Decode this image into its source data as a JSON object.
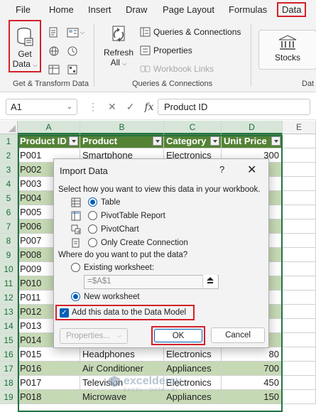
{
  "ribbon": {
    "tabs": [
      "File",
      "Home",
      "Insert",
      "Draw",
      "Page Layout",
      "Formulas",
      "Data"
    ],
    "active_tab": "Data",
    "get_data_label_1": "Get",
    "get_data_label_2": "Data",
    "refresh_label_1": "Refresh",
    "refresh_label_2": "All",
    "queries_connections": "Queries & Connections",
    "properties": "Properties",
    "workbook_links": "Workbook Links",
    "stocks": "Stocks",
    "group_get_transform": "Get & Transform Data",
    "group_queries": "Queries & Connections",
    "group_datatypes_partial": "Dat"
  },
  "formula_bar": {
    "name_box": "A1",
    "fx_symbol": "fx",
    "value": "Product ID"
  },
  "grid": {
    "columns": [
      "A",
      "B",
      "C",
      "D",
      "E"
    ],
    "rows": [
      "1",
      "2",
      "3",
      "4",
      "5",
      "6",
      "7",
      "8",
      "9",
      "10",
      "11",
      "12",
      "13",
      "14",
      "15",
      "16",
      "17",
      "18",
      "19"
    ],
    "headers": [
      "Product ID",
      "Product",
      "Category",
      "Unit Price"
    ],
    "data": [
      [
        "P001",
        "Smartphone",
        "Electronics",
        "300"
      ],
      [
        "P002",
        "",
        "",
        ""
      ],
      [
        "P003",
        "",
        "",
        ""
      ],
      [
        "P004",
        "",
        "",
        ""
      ],
      [
        "P005",
        "",
        "",
        ""
      ],
      [
        "P006",
        "",
        "",
        ""
      ],
      [
        "P007",
        "",
        "",
        ""
      ],
      [
        "P008",
        "",
        "",
        ""
      ],
      [
        "P009",
        "",
        "",
        ""
      ],
      [
        "P010",
        "",
        "",
        ""
      ],
      [
        "P011",
        "",
        "",
        ""
      ],
      [
        "P012",
        "",
        "",
        ""
      ],
      [
        "P013",
        "",
        "",
        ""
      ],
      [
        "P014",
        "",
        "",
        ""
      ],
      [
        "P015",
        "Headphones",
        "Electronics",
        "80"
      ],
      [
        "P016",
        "Air Conditioner",
        "Appliances",
        "700"
      ],
      [
        "P017",
        "Television",
        "Electronics",
        "450"
      ],
      [
        "P018",
        "Microwave",
        "Appliances",
        "150"
      ]
    ]
  },
  "dialog": {
    "title": "Import Data",
    "help": "?",
    "close": "✕",
    "prompt_view": "Select how you want to view this data in your workbook.",
    "options_view": [
      "Table",
      "PivotTable Report",
      "PivotChart",
      "Only Create Connection"
    ],
    "selected_view": "Table",
    "prompt_location": "Where do you want to put the data?",
    "existing_worksheet": "Existing worksheet:",
    "ref_value": "=$A$1",
    "new_worksheet": "New worksheet",
    "data_model_label": "Add this data to the Data Model",
    "properties_button": "Properties...",
    "ok_button": "OK",
    "cancel_button": "Cancel"
  },
  "watermark": {
    "name": "exceldemy",
    "sub": "EXCEL · DATA · BI"
  },
  "colors": {
    "accent_red": "#d32029",
    "header_green": "#548235",
    "band_green": "#c6d9b5",
    "excel_green": "#217346",
    "dialog_blue": "#005fb8"
  }
}
